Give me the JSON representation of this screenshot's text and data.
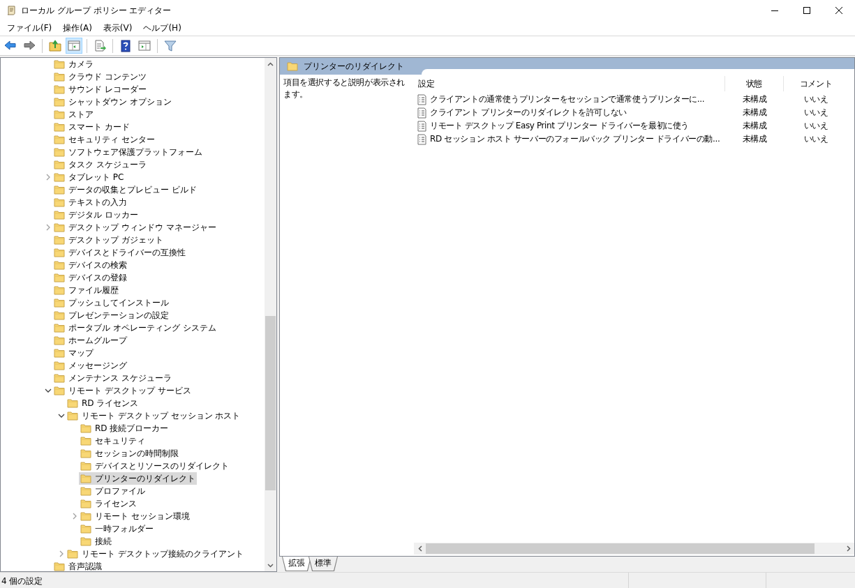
{
  "window": {
    "title": "ローカル グループ ポリシー エディター"
  },
  "menu": [
    "ファイル(F)",
    "操作(A)",
    "表示(V)",
    "ヘルプ(H)"
  ],
  "toolbar": [
    {
      "kind": "back",
      "pressed": false
    },
    {
      "kind": "forward",
      "pressed": false
    },
    {
      "kind": "sep"
    },
    {
      "kind": "folder-up",
      "pressed": false
    },
    {
      "kind": "tree-pane",
      "pressed": true
    },
    {
      "kind": "sep"
    },
    {
      "kind": "export",
      "pressed": false
    },
    {
      "kind": "sep"
    },
    {
      "kind": "help",
      "pressed": false
    },
    {
      "kind": "detail-pane",
      "pressed": false
    },
    {
      "kind": "sep"
    },
    {
      "kind": "filter",
      "pressed": false
    }
  ],
  "tree": [
    {
      "label": "カメラ",
      "selected": false
    },
    {
      "label": "クラウド コンテンツ",
      "selected": false
    },
    {
      "label": "サウンド レコーダー",
      "selected": false
    },
    {
      "label": "シャットダウン オプション",
      "selected": false
    },
    {
      "label": "ストア",
      "selected": false
    },
    {
      "label": "スマート カード",
      "selected": false
    },
    {
      "label": "セキュリティ センター",
      "selected": false
    },
    {
      "label": "ソフトウェア保護プラットフォーム",
      "selected": false
    },
    {
      "label": "タスク スケジューラ",
      "selected": false
    },
    {
      "label": "タブレット PC",
      "selected": false,
      "expanded": false
    },
    {
      "label": "データの収集とプレビュー ビルド",
      "selected": false
    },
    {
      "label": "テキストの入力",
      "selected": false
    },
    {
      "label": "デジタル ロッカー",
      "selected": false
    },
    {
      "label": "デスクトップ ウィンドウ マネージャー",
      "selected": false,
      "expanded": false
    },
    {
      "label": "デスクトップ ガジェット",
      "selected": false
    },
    {
      "label": "デバイスとドライバーの互換性",
      "selected": false
    },
    {
      "label": "デバイスの検索",
      "selected": false
    },
    {
      "label": "デバイスの登録",
      "selected": false
    },
    {
      "label": "ファイル履歴",
      "selected": false
    },
    {
      "label": "プッシュしてインストール",
      "selected": false
    },
    {
      "label": "プレゼンテーションの設定",
      "selected": false
    },
    {
      "label": "ポータブル オペレーティング システム",
      "selected": false
    },
    {
      "label": "ホームグループ",
      "selected": false
    },
    {
      "label": "マップ",
      "selected": false
    },
    {
      "label": "メッセージング",
      "selected": false
    },
    {
      "label": "メンテナンス スケジューラ",
      "selected": false
    },
    {
      "label": "リモート デスクトップ サービス",
      "selected": false,
      "expanded": true,
      "children": [
        {
          "label": "RD ライセンス",
          "selected": false
        },
        {
          "label": "リモート デスクトップ セッション ホスト",
          "selected": false,
          "expanded": true,
          "children": [
            {
              "label": "RD 接続ブローカー",
              "selected": false
            },
            {
              "label": "セキュリティ",
              "selected": false
            },
            {
              "label": "セッションの時間制限",
              "selected": false
            },
            {
              "label": "デバイスとリソースのリダイレクト",
              "selected": false
            },
            {
              "label": "プリンターのリダイレクト",
              "selected": true
            },
            {
              "label": "プロファイル",
              "selected": false
            },
            {
              "label": "ライセンス",
              "selected": false
            },
            {
              "label": "リモート セッション環境",
              "selected": false,
              "expanded": false
            },
            {
              "label": "一時フォルダー",
              "selected": false
            },
            {
              "label": "接続",
              "selected": false
            }
          ]
        },
        {
          "label": "リモート デスクトップ接続のクライアント",
          "selected": false,
          "expanded": false
        }
      ]
    },
    {
      "label": "音声認識",
      "selected": false
    }
  ],
  "detail": {
    "title": "プリンターのリダイレクト",
    "description": "項目を選択すると説明が表示されます。",
    "columns": [
      "設定",
      "状態",
      "コメント"
    ],
    "rows": [
      {
        "setting": "クライアントの通常使うプリンターをセッションで通常使うプリンターに...",
        "state": "未構成",
        "comment": "いいえ"
      },
      {
        "setting": "クライアント プリンターのリダイレクトを許可しない",
        "state": "未構成",
        "comment": "いいえ"
      },
      {
        "setting": "リモート デスクトップ Easy Print プリンター ドライバーを最初に使う",
        "state": "未構成",
        "comment": "いいえ"
      },
      {
        "setting": "RD セッション ホスト サーバーのフォールバック プリンター ドライバーの動...",
        "state": "未構成",
        "comment": "いいえ"
      }
    ]
  },
  "view_tabs": [
    {
      "label": "拡張",
      "selected": true
    },
    {
      "label": "標準",
      "selected": false
    }
  ],
  "status_bar": "4 個の設定"
}
